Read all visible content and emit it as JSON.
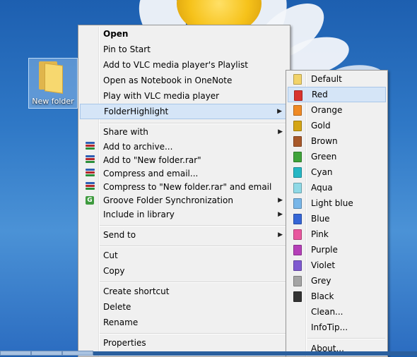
{
  "desktop": {
    "icon_label": "New folder"
  },
  "context_menu": {
    "items": [
      {
        "label": "Open"
      },
      {
        "label": "Pin to Start"
      },
      {
        "label": "Add to VLC media player's Playlist"
      },
      {
        "label": "Open as Notebook in OneNote"
      },
      {
        "label": "Play with VLC media player"
      },
      {
        "label": "FolderHighlight"
      },
      {
        "label": "Share with"
      },
      {
        "label": "Add to archive..."
      },
      {
        "label": "Add to \"New folder.rar\""
      },
      {
        "label": "Compress and email..."
      },
      {
        "label": "Compress to \"New folder.rar\" and email"
      },
      {
        "label": "Groove Folder Synchronization"
      },
      {
        "label": "Include in library"
      },
      {
        "label": "Send to"
      },
      {
        "label": "Cut"
      },
      {
        "label": "Copy"
      },
      {
        "label": "Create shortcut"
      },
      {
        "label": "Delete"
      },
      {
        "label": "Rename"
      },
      {
        "label": "Properties"
      }
    ],
    "submenu_arrow": "▶"
  },
  "folder_highlight_menu": {
    "items": [
      {
        "label": "Default",
        "color": "#f2d36a"
      },
      {
        "label": "Red",
        "color": "#d8332e"
      },
      {
        "label": "Orange",
        "color": "#f08a24"
      },
      {
        "label": "Gold",
        "color": "#d4a514"
      },
      {
        "label": "Brown",
        "color": "#a8592a"
      },
      {
        "label": "Green",
        "color": "#3fa33a"
      },
      {
        "label": "Cyan",
        "color": "#26b7c4"
      },
      {
        "label": "Aqua",
        "color": "#8fd9e6"
      },
      {
        "label": "Light blue",
        "color": "#78b6e8"
      },
      {
        "label": "Blue",
        "color": "#3566d6"
      },
      {
        "label": "Pink",
        "color": "#e8579e"
      },
      {
        "label": "Purple",
        "color": "#b53fb8"
      },
      {
        "label": "Violet",
        "color": "#7f5ad0"
      },
      {
        "label": "Grey",
        "color": "#a4a4a4"
      },
      {
        "label": "Black",
        "color": "#333333"
      },
      {
        "label": "Clean..."
      },
      {
        "label": "InfoTip..."
      },
      {
        "label": "About..."
      }
    ]
  },
  "colors": {
    "menu_bg": "#f0f0f0",
    "highlight_bg": "#d5e5f7",
    "highlight_border": "#a8c6e8",
    "desktop_blue": "#2f78c6"
  }
}
